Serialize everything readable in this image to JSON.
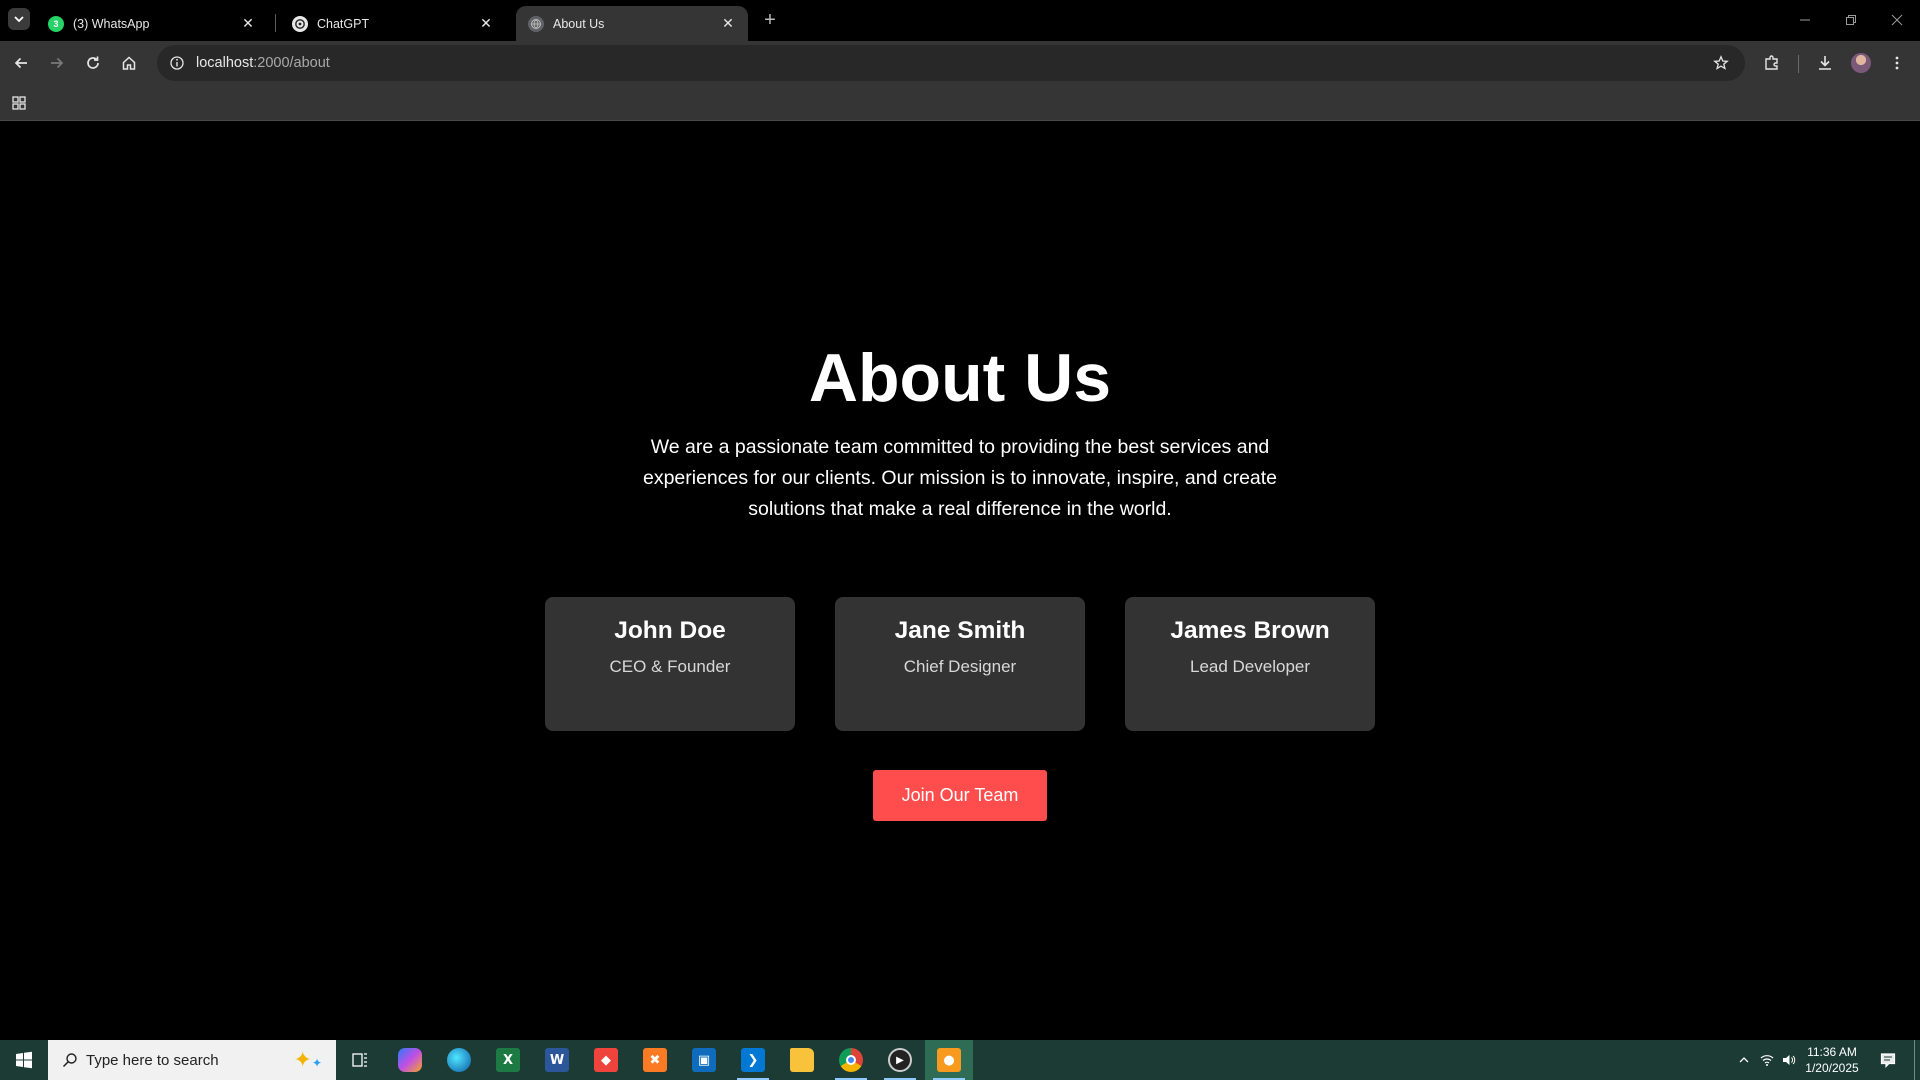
{
  "browser": {
    "tabs": [
      {
        "title": "(3) WhatsApp",
        "badge": "3",
        "active": false
      },
      {
        "title": "ChatGPT",
        "active": false
      },
      {
        "title": "About Us",
        "active": true
      }
    ],
    "url_host": "localhost",
    "url_rest": ":2000/about"
  },
  "page": {
    "heading": "About Us",
    "intro_lines": [
      "We are a passionate team committed to providing the best services and",
      "experiences for our clients. Our mission is to innovate, inspire, and create",
      "solutions that make a real difference in the world."
    ],
    "team": [
      {
        "name": "John Doe",
        "role": "CEO & Founder"
      },
      {
        "name": "Jane Smith",
        "role": "Chief Designer"
      },
      {
        "name": "James Brown",
        "role": "Lead Developer"
      }
    ],
    "cta_label": "Join Our Team"
  },
  "taskbar": {
    "search_placeholder": "Type here to search",
    "time": "11:36 AM",
    "date": "1/20/2025",
    "apps": [
      "task-view",
      "copilot",
      "edge",
      "excel",
      "word",
      "anydesk",
      "xampp",
      "store",
      "vscode",
      "file-explorer",
      "chrome",
      "media-player",
      "app"
    ]
  },
  "colors": {
    "accent_button": "#ff4d4d",
    "card_bg": "#333333",
    "page_bg": "#000000",
    "taskbar_bg": "#1b3b34"
  }
}
